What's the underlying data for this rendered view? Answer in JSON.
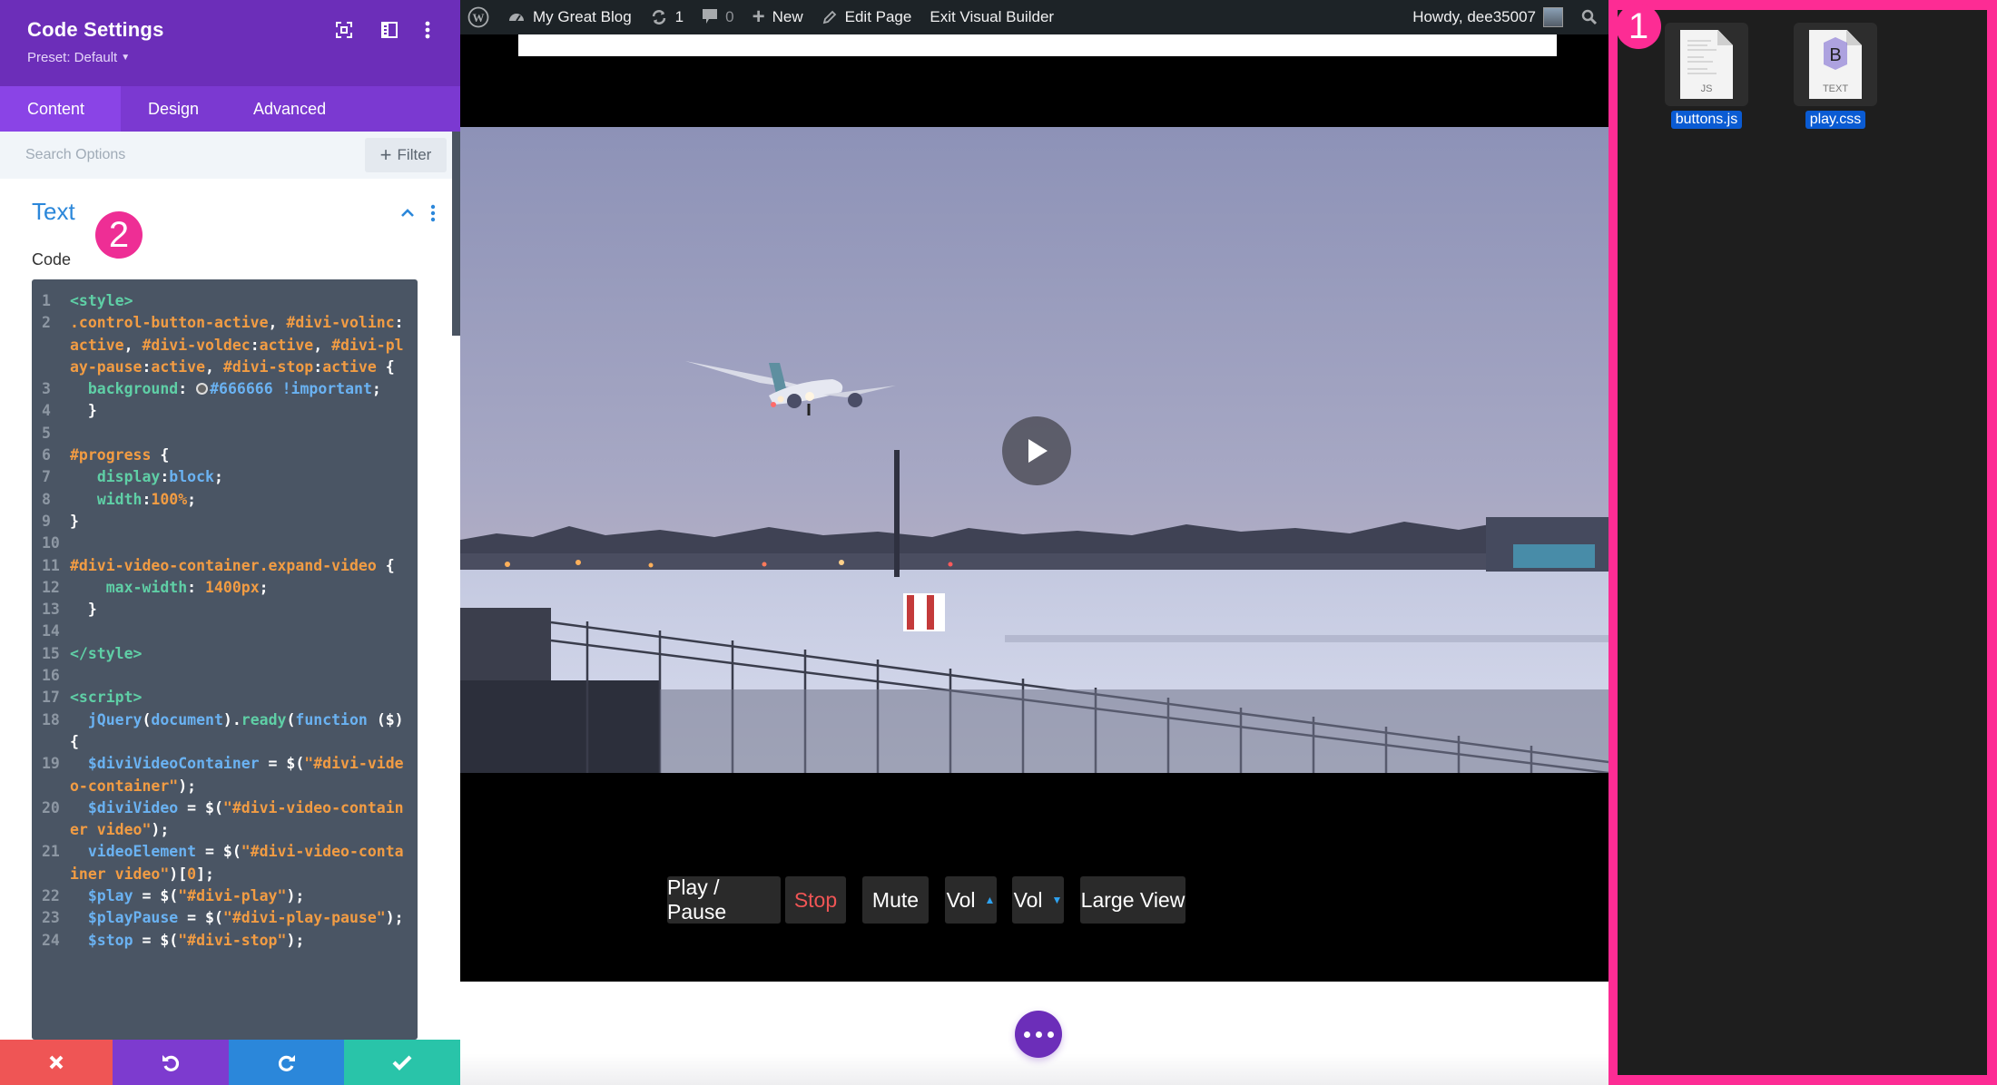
{
  "sidebar": {
    "title": "Code Settings",
    "preset": "Preset: Default",
    "tabs": [
      {
        "label": "Content",
        "active": true
      },
      {
        "label": "Design",
        "active": false
      },
      {
        "label": "Advanced",
        "active": false
      }
    ],
    "search_placeholder": "Search Options",
    "filter_label": "Filter",
    "section_title": "Text",
    "field_label": "Code",
    "annotation_badge": "2",
    "code_lines": [
      {
        "n": "1",
        "html": "<span class='t-tag'>&lt;style&gt;</span>"
      },
      {
        "n": "2",
        "html": "<span class='t-sel'>.control-button-active</span><span class='t-plain'>, </span><span class='t-sel'>#divi-volinc</span><span class='t-plain'>:</span><span class='t-sel'>active</span><span class='t-plain'>, </span><span class='t-sel'>#divi-voldec</span><span class='t-plain'>:</span><span class='t-sel'>active</span><span class='t-plain'>, </span><span class='t-sel'>#divi-play-pause</span><span class='t-plain'>:</span><span class='t-sel'>active</span><span class='t-plain'>, </span><span class='t-sel'>#divi-stop</span><span class='t-plain'>:</span><span class='t-sel'>active</span><span class='t-plain'> {</span>"
      },
      {
        "n": "3",
        "html": "<span class='t-prop'>  background</span><span class='t-plain'>: </span><span class='swatch'></span><span class='t-val'>#666666</span> <span class='t-val'>!important</span><span class='t-plain'>;</span>"
      },
      {
        "n": "4",
        "html": "<span class='t-plain'>  }</span>"
      },
      {
        "n": "5",
        "html": ""
      },
      {
        "n": "6",
        "html": "<span class='t-sel'>#progress</span><span class='t-plain'> {</span>"
      },
      {
        "n": "7",
        "html": "<span class='t-prop'>   display</span><span class='t-plain'>:</span><span class='t-val'>block</span><span class='t-plain'>;</span>"
      },
      {
        "n": "8",
        "html": "<span class='t-prop'>   width</span><span class='t-plain'>:</span><span class='t-num'>100%</span><span class='t-plain'>;</span>"
      },
      {
        "n": "9",
        "html": "<span class='t-plain'>}</span>"
      },
      {
        "n": "10",
        "html": ""
      },
      {
        "n": "11",
        "html": "<span class='t-sel'>#divi-video-container.expand-video</span> <span class='t-plain'>{</span>"
      },
      {
        "n": "12",
        "html": "<span class='t-prop'>    max-width</span><span class='t-plain'>: </span><span class='t-num'>1400px</span><span class='t-plain'>;</span>"
      },
      {
        "n": "13",
        "html": "<span class='t-plain'>  }</span>"
      },
      {
        "n": "14",
        "html": ""
      },
      {
        "n": "15",
        "html": "<span class='t-tag'>&lt;/style&gt;</span>"
      },
      {
        "n": "16",
        "html": ""
      },
      {
        "n": "17",
        "html": "<span class='t-tag'>&lt;script&gt;</span>"
      },
      {
        "n": "18",
        "html": "<span class='t-kw'>  jQuery</span><span class='t-plain'>(</span><span class='t-kw'>document</span><span class='t-plain'>).</span><span class='t-fn'>ready</span><span class='t-plain'>(</span><span class='t-kw'>function</span> <span class='t-plain'>($) {</span>"
      },
      {
        "n": "19",
        "html": "<span class='t-kw'>  $diviVideoContainer</span><span class='t-plain'> = $(</span><span class='t-str'>\"#divi-video-container\"</span><span class='t-plain'>);</span>"
      },
      {
        "n": "20",
        "html": "<span class='t-kw'>  $diviVideo</span><span class='t-plain'> = $(</span><span class='t-str'>\"#divi-video-container video\"</span><span class='t-plain'>);</span>"
      },
      {
        "n": "21",
        "html": "<span class='t-kw'>  videoElement</span><span class='t-plain'> = $(</span><span class='t-str'>\"#divi-video-container video\"</span><span class='t-plain'>)[</span><span class='t-num'>0</span><span class='t-plain'>];</span>"
      },
      {
        "n": "22",
        "html": "<span class='t-kw'>  $play</span><span class='t-plain'> = $(</span><span class='t-str'>\"#divi-play\"</span><span class='t-plain'>);</span>"
      },
      {
        "n": "23",
        "html": "<span class='t-kw'>  $playPause</span><span class='t-plain'> = $(</span><span class='t-str'>\"#divi-play-pause\"</span><span class='t-plain'>);</span>"
      },
      {
        "n": "24",
        "html": "<span class='t-kw'>  $stop</span><span class='t-plain'> = $(</span><span class='t-str'>\"#divi-stop\"</span><span class='t-plain'>);</span>"
      }
    ],
    "footer_buttons": [
      {
        "name": "discard",
        "icon": "close-icon",
        "color": "#ef5555"
      },
      {
        "name": "undo",
        "icon": "undo-icon",
        "color": "#7d3bcf"
      },
      {
        "name": "redo",
        "icon": "redo-icon",
        "color": "#2b87da"
      },
      {
        "name": "save",
        "icon": "check-icon",
        "color": "#29c4a9"
      }
    ]
  },
  "adminbar": {
    "site_name": "My Great Blog",
    "updates_count": "1",
    "comments_count": "0",
    "new_label": "New",
    "edit_label": "Edit Page",
    "exit_label": "Exit Visual Builder",
    "greeting": "Howdy, dee35007"
  },
  "player": {
    "controls": [
      {
        "label": "Play / Pause",
        "color": "#ffffff"
      },
      {
        "label": "Stop",
        "color": "#ef5555"
      },
      {
        "label": "Mute",
        "color": "#ffffff"
      },
      {
        "label": "Vol",
        "arrow": "▲",
        "color": "#ffffff"
      },
      {
        "label": "Vol",
        "arrow": "▼",
        "color": "#ffffff"
      },
      {
        "label": "Large View",
        "color": "#ffffff"
      }
    ]
  },
  "finder": {
    "annotation_badge": "1",
    "files": [
      {
        "name": "buttons.js",
        "type_label": "JS"
      },
      {
        "name": "play.css",
        "type_label": "TEXT"
      }
    ]
  },
  "colors": {
    "divi_purple": "#6c2eb9",
    "annotation_pink": "#fd2c94",
    "link_blue": "#2b87da"
  }
}
